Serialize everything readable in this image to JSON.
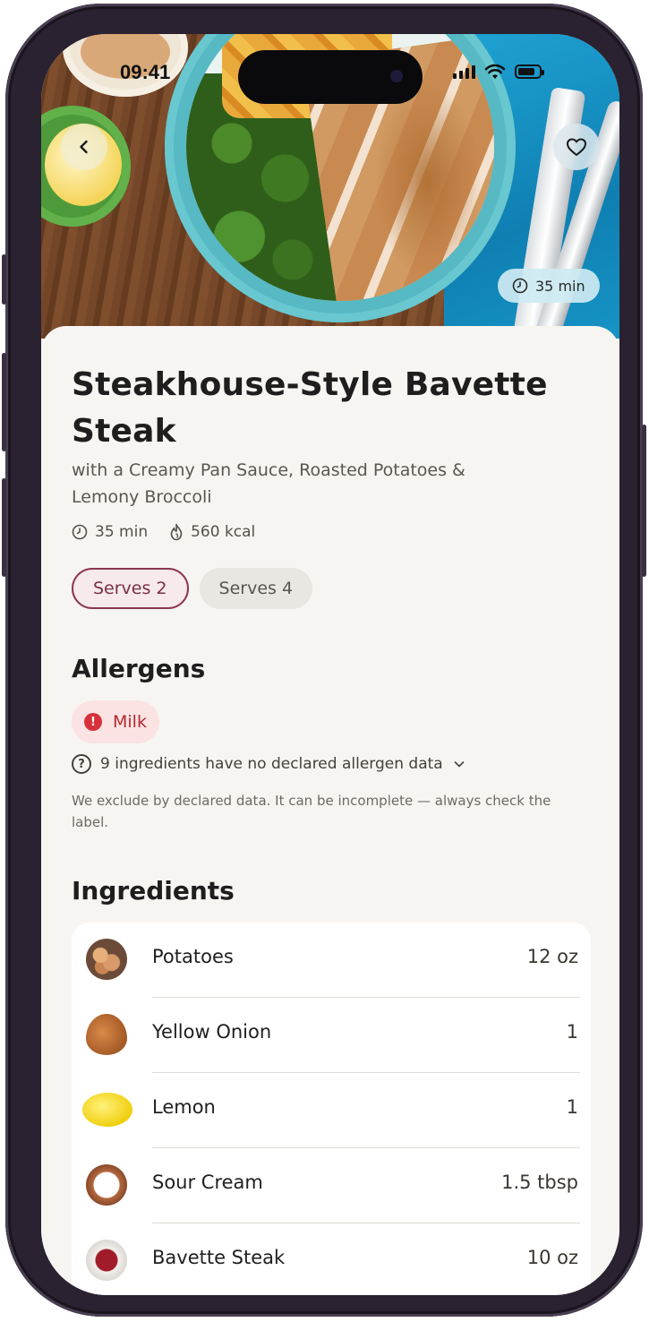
{
  "status_bar": {
    "time": "09:41"
  },
  "hero": {
    "cook_time_chip": "35 min"
  },
  "recipe": {
    "title": "Steakhouse-Style Bavette Steak",
    "subtitle": "with a Creamy Pan Sauce, Roasted Potatoes & Lemony Broccoli",
    "time": "35 min",
    "calories": "560 kcal",
    "serves": [
      {
        "label": "Serves 2",
        "selected": true
      },
      {
        "label": "Serves 4",
        "selected": false
      }
    ]
  },
  "allergens": {
    "heading": "Allergens",
    "items": [
      "Milk"
    ],
    "no_data_note": "9 ingredients have no declared allergen data",
    "disclaimer": "We exclude by declared data. It can be incomplete — always check the label."
  },
  "ingredients": {
    "heading": "Ingredients",
    "items": [
      {
        "name": "Potatoes",
        "qty": "12 oz",
        "icon": "potatoes-icon"
      },
      {
        "name": "Yellow Onion",
        "qty": "1",
        "icon": "onion-icon"
      },
      {
        "name": "Lemon",
        "qty": "1",
        "icon": "lemon-icon"
      },
      {
        "name": "Sour Cream",
        "qty": "1.5 tbsp",
        "icon": "sour-cream-icon"
      },
      {
        "name": "Bavette Steak",
        "qty": "10 oz",
        "icon": "steak-icon"
      }
    ]
  },
  "colors": {
    "accent": "#8c3650",
    "allergen_red": "#d6313a",
    "background": "#f7f5f2"
  }
}
